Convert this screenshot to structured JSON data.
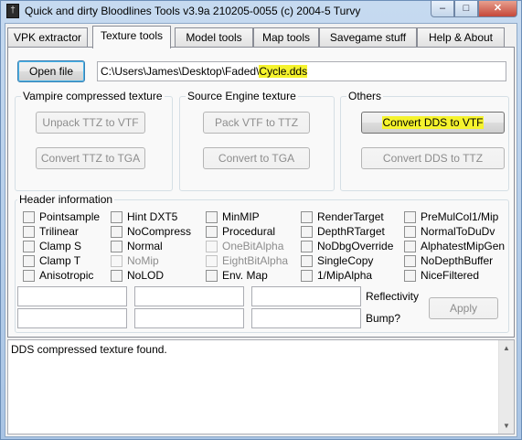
{
  "window": {
    "title": "Quick and dirty Bloodlines Tools v3.9a 210205-0055 (c) 2004-5 Turvy",
    "icon": "vampire-icon",
    "minimize_glyph": "–",
    "maximize_glyph": "□",
    "close_glyph": "✕"
  },
  "tabs": [
    {
      "label": "VPK extractor"
    },
    {
      "label": "Texture tools",
      "active": true
    },
    {
      "label": "Model tools"
    },
    {
      "label": "Map tools"
    },
    {
      "label": "Savegame stuff"
    },
    {
      "label": "Help & About"
    }
  ],
  "file": {
    "open_label": "Open file",
    "path_prefix": "C:\\Users\\James\\Desktop\\Faded\\",
    "path_highlight": "Cycle.dds"
  },
  "vampire_group": {
    "title": "Vampire compressed texture",
    "unpack_label": "Unpack TTZ to VTF",
    "convert_label": "Convert TTZ to TGA"
  },
  "source_group": {
    "title": "Source Engine texture",
    "pack_label": "Pack VTF to TTZ",
    "convert_label": "Convert to TGA"
  },
  "others_group": {
    "title": "Others",
    "dds_vtf_label": "Convert DDS to VTF",
    "dds_ttz_label": "Convert DDS to TTZ"
  },
  "header": {
    "title": "Header information",
    "flags": [
      "Pointsample",
      "Trilinear",
      "Clamp S",
      "Clamp T",
      "Anisotropic",
      "Hint DXT5",
      "NoCompress",
      "Normal",
      "NoMip",
      "NoLOD",
      "MinMIP",
      "Procedural",
      "OneBitAlpha",
      "EightBitAlpha",
      "Env. Map",
      "RenderTarget",
      "DepthRTarget",
      "NoDbgOverride",
      "SingleCopy",
      "1/MipAlpha",
      "PreMulCol1/Mip",
      "NormalToDuDv",
      "AlphatestMipGen",
      "NoDepthBuffer",
      "NiceFiltered"
    ],
    "reflectivity_label": "Reflectivity",
    "bump_label": "Bump?",
    "apply_label": "Apply",
    "fields": [
      "",
      "",
      "",
      "",
      "",
      ""
    ]
  },
  "status": {
    "message": "DDS compressed texture found."
  }
}
